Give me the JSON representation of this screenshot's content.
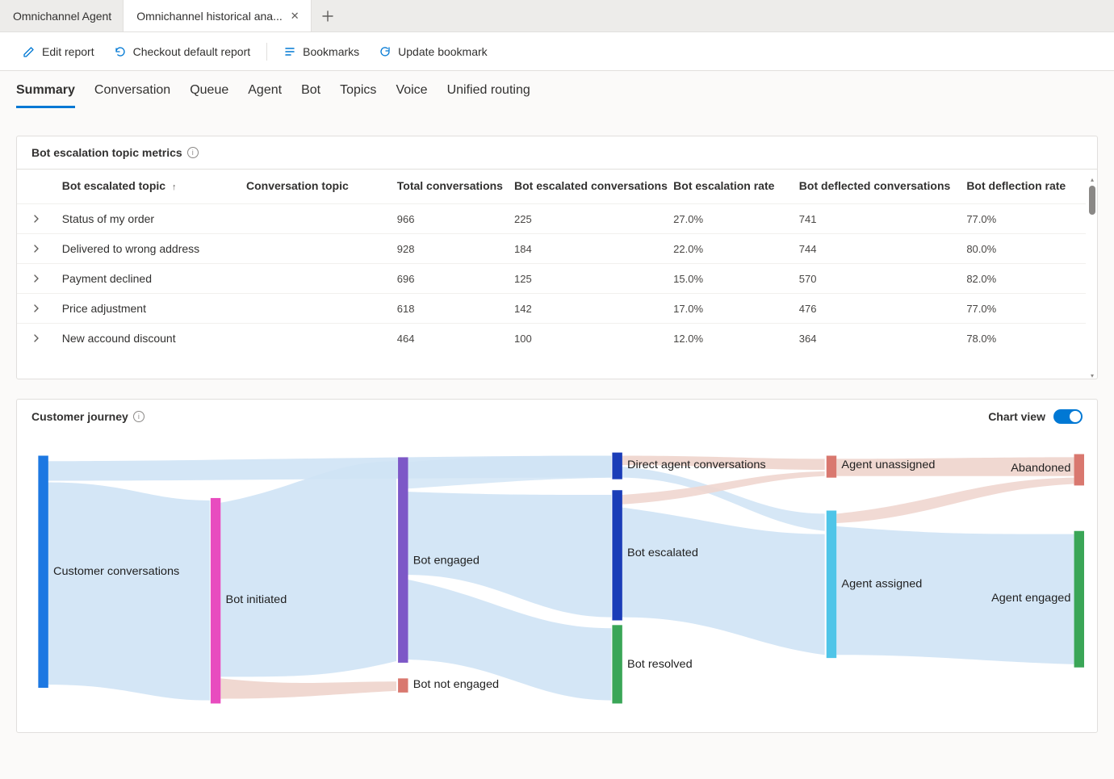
{
  "app_tabs": {
    "inactive_label": "Omnichannel Agent",
    "active_label": "Omnichannel historical ana..."
  },
  "cmdbar": {
    "edit": "Edit report",
    "checkout": "Checkout default report",
    "bookmarks": "Bookmarks",
    "update": "Update bookmark"
  },
  "report_tabs": [
    "Summary",
    "Conversation",
    "Queue",
    "Agent",
    "Bot",
    "Topics",
    "Voice",
    "Unified routing"
  ],
  "metrics_card": {
    "title": "Bot escalation topic metrics",
    "columns": {
      "c0": "Bot escalated topic",
      "c1": "Conversation topic",
      "c2": "Total conversations",
      "c3": "Bot escalated conversations",
      "c4": "Bot escalation rate",
      "c5": "Bot deflected conversations",
      "c6": "Bot deflection rate"
    },
    "rows": [
      {
        "topic": "Status of my order",
        "total": "966",
        "esc": "225",
        "esc_rate": "27.0%",
        "defl": "741",
        "defl_rate": "77.0%"
      },
      {
        "topic": "Delivered to wrong address",
        "total": "928",
        "esc": "184",
        "esc_rate": "22.0%",
        "defl": "744",
        "defl_rate": "80.0%"
      },
      {
        "topic": "Payment declined",
        "total": "696",
        "esc": "125",
        "esc_rate": "15.0%",
        "defl": "570",
        "defl_rate": "82.0%"
      },
      {
        "topic": "Price adjustment",
        "total": "618",
        "esc": "142",
        "esc_rate": "17.0%",
        "defl": "476",
        "defl_rate": "77.0%"
      },
      {
        "topic": "New accound discount",
        "total": "464",
        "esc": "100",
        "esc_rate": "12.0%",
        "defl": "364",
        "defl_rate": "78.0%"
      }
    ]
  },
  "journey_card": {
    "title": "Customer journey",
    "toggle_label": "Chart view"
  },
  "chart_data": {
    "type": "sankey",
    "title": "Customer journey",
    "nodes": [
      {
        "id": "customer",
        "label": "Customer conversations",
        "color": "#1d78e2"
      },
      {
        "id": "bot_init",
        "label": "Bot initiated",
        "color": "#e84cbf"
      },
      {
        "id": "bot_eng",
        "label": "Bot engaged",
        "color": "#7d58c7"
      },
      {
        "id": "bot_not",
        "label": "Bot not engaged",
        "color": "#d9786f"
      },
      {
        "id": "direct",
        "label": "Direct agent conversations",
        "color": "#1b3db8"
      },
      {
        "id": "bot_esc",
        "label": "Bot escalated",
        "color": "#1b3db8"
      },
      {
        "id": "bot_res",
        "label": "Bot resolved",
        "color": "#3aa657"
      },
      {
        "id": "agent_un",
        "label": "Agent unassigned",
        "color": "#d9786f"
      },
      {
        "id": "agent_as",
        "label": "Agent assigned",
        "color": "#4fc5e8"
      },
      {
        "id": "abandon",
        "label": "Abandoned",
        "color": "#d9786f"
      },
      {
        "id": "agent_eng",
        "label": "Agent engaged",
        "color": "#3aa657"
      }
    ],
    "links": [
      {
        "source": "customer",
        "target": "direct",
        "value": 10,
        "color": "#cfe3f5"
      },
      {
        "source": "customer",
        "target": "bot_init",
        "value": 90,
        "color": "#cfe3f5"
      },
      {
        "source": "bot_init",
        "target": "bot_eng",
        "value": 82,
        "color": "#cfe3f5"
      },
      {
        "source": "bot_init",
        "target": "bot_not",
        "value": 8,
        "color": "#efd6cf"
      },
      {
        "source": "bot_eng",
        "target": "direct",
        "value": 8,
        "color": "#cfe3f5"
      },
      {
        "source": "bot_eng",
        "target": "bot_esc",
        "value": 50,
        "color": "#cfe3f5"
      },
      {
        "source": "bot_eng",
        "target": "bot_res",
        "value": 24,
        "color": "#cfe3f5"
      },
      {
        "source": "direct",
        "target": "agent_un",
        "value": 6,
        "color": "#efd6cf"
      },
      {
        "source": "direct",
        "target": "agent_as",
        "value": 12,
        "color": "#cfe3f5"
      },
      {
        "source": "bot_esc",
        "target": "agent_un",
        "value": 4,
        "color": "#efd6cf"
      },
      {
        "source": "bot_esc",
        "target": "agent_as",
        "value": 46,
        "color": "#cfe3f5"
      },
      {
        "source": "agent_un",
        "target": "abandon",
        "value": 10,
        "color": "#efd6cf"
      },
      {
        "source": "agent_as",
        "target": "abandon",
        "value": 4,
        "color": "#efd6cf"
      },
      {
        "source": "agent_as",
        "target": "agent_eng",
        "value": 54,
        "color": "#cfe3f5"
      }
    ]
  }
}
